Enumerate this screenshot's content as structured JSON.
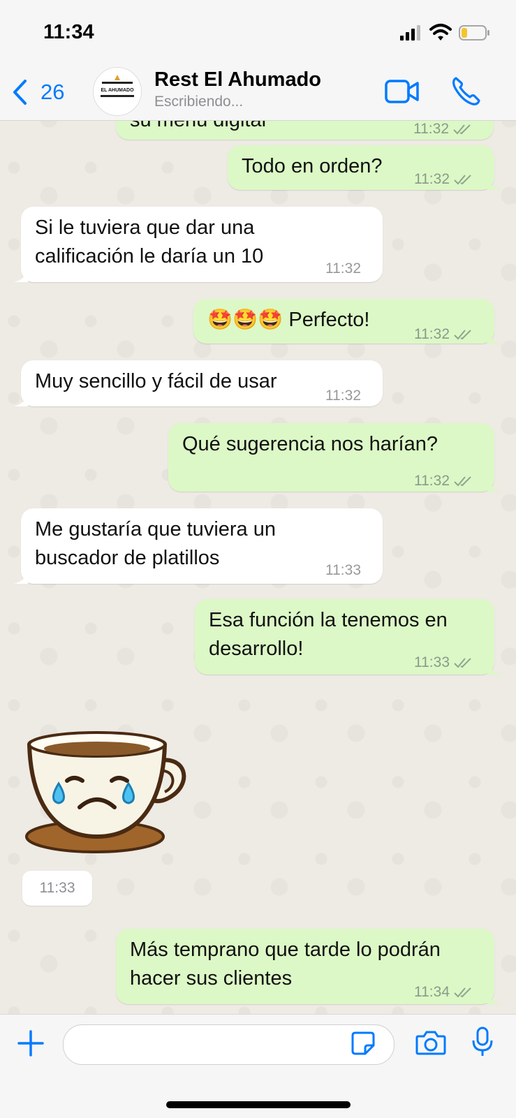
{
  "status_bar": {
    "time": "11:34"
  },
  "header": {
    "back_count": "26",
    "contact_name": "Rest El Ahumado",
    "status": "Escribiendo...",
    "avatar_logo_text": "EL AHUMADO"
  },
  "messages": [
    {
      "dir": "out",
      "text": "su menú digital",
      "time": "11:32"
    },
    {
      "dir": "out",
      "text": "Todo en orden?",
      "time": "11:32"
    },
    {
      "dir": "in",
      "text": "Si le tuviera que dar una\ncalificación le daría un 10",
      "time": "11:32"
    },
    {
      "dir": "out",
      "text": "🤩🤩🤩 Perfecto!",
      "time": "11:32"
    },
    {
      "dir": "in",
      "text": "Muy sencillo y fácil de usar",
      "time": "11:32"
    },
    {
      "dir": "out",
      "text": "Qué sugerencia nos harían?",
      "time": "11:32"
    },
    {
      "dir": "in",
      "text": "Me gustaría que tuviera un\nbuscador de platillos",
      "time": "11:33"
    },
    {
      "dir": "out",
      "text": "Esa función la tenemos en\ndesarrollo!",
      "time": "11:33"
    },
    {
      "dir": "in",
      "type": "sticker",
      "sticker": "crying-coffee-cup-sticker",
      "time": "11:33"
    },
    {
      "dir": "out",
      "text": "Más temprano que tarde lo podrán\nhacer sus clientes",
      "time": "11:34"
    }
  ],
  "input": {
    "placeholder": ""
  },
  "colors": {
    "outgoing": "#dcf8c6",
    "incoming": "#ffffff",
    "accent": "#007aff"
  }
}
